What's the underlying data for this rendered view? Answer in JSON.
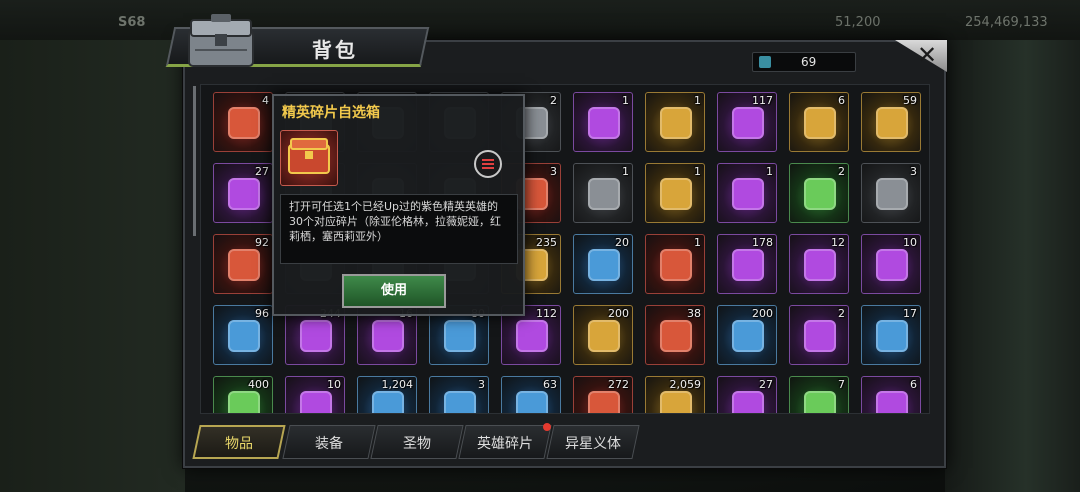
{
  "background": {
    "level": "S68",
    "gold": "51,200",
    "power": "254,469,133"
  },
  "title": "背包",
  "close_label": "✕",
  "counter": {
    "value": "69"
  },
  "popup": {
    "title": "精英碎片自选箱",
    "description": "打开可任选1个已经Up过的紫色精英英雄的30个对应碎片（除亚伦格林，拉薇妮娅，红莉栖，塞西莉亚外）",
    "use_label": "使用"
  },
  "items": [
    {
      "qty": "4",
      "color": "red"
    },
    {
      "qty": "",
      "color": "gray"
    },
    {
      "qty": "",
      "color": "gray"
    },
    {
      "qty": "",
      "color": "gray"
    },
    {
      "qty": "2",
      "color": "gray"
    },
    {
      "qty": "1",
      "color": "purple"
    },
    {
      "qty": "1",
      "color": "gold"
    },
    {
      "qty": "117",
      "color": "purple"
    },
    {
      "qty": "6",
      "color": "gold"
    },
    {
      "qty": "59",
      "color": "gold"
    },
    {
      "qty": "27",
      "color": "purple"
    },
    {
      "qty": "",
      "color": "gray"
    },
    {
      "qty": "",
      "color": "gray"
    },
    {
      "qty": "",
      "color": "gray"
    },
    {
      "qty": "3",
      "color": "red"
    },
    {
      "qty": "1",
      "color": "gray"
    },
    {
      "qty": "1",
      "color": "gold"
    },
    {
      "qty": "1",
      "color": "purple"
    },
    {
      "qty": "2",
      "color": "green"
    },
    {
      "qty": "3",
      "color": "gray"
    },
    {
      "qty": "92",
      "color": "red"
    },
    {
      "qty": "",
      "color": "gray"
    },
    {
      "qty": "",
      "color": "gray"
    },
    {
      "qty": "",
      "color": "gray"
    },
    {
      "qty": "235",
      "color": "gold"
    },
    {
      "qty": "20",
      "color": "blue"
    },
    {
      "qty": "1",
      "color": "red"
    },
    {
      "qty": "178",
      "color": "purple"
    },
    {
      "qty": "12",
      "color": "purple"
    },
    {
      "qty": "10",
      "color": "purple"
    },
    {
      "qty": "96",
      "color": "blue"
    },
    {
      "qty": "244",
      "color": "purple"
    },
    {
      "qty": "16",
      "color": "purple"
    },
    {
      "qty": "80",
      "color": "blue"
    },
    {
      "qty": "112",
      "color": "purple"
    },
    {
      "qty": "200",
      "color": "gold"
    },
    {
      "qty": "38",
      "color": "red"
    },
    {
      "qty": "200",
      "color": "blue"
    },
    {
      "qty": "2",
      "color": "purple"
    },
    {
      "qty": "17",
      "color": "blue"
    },
    {
      "qty": "400",
      "color": "green"
    },
    {
      "qty": "10",
      "color": "purple"
    },
    {
      "qty": "1,204",
      "color": "blue"
    },
    {
      "qty": "3",
      "color": "blue"
    },
    {
      "qty": "63",
      "color": "blue"
    },
    {
      "qty": "272",
      "color": "red"
    },
    {
      "qty": "2,059",
      "color": "gold"
    },
    {
      "qty": "27",
      "color": "purple"
    },
    {
      "qty": "7",
      "color": "green"
    },
    {
      "qty": "6",
      "color": "purple"
    }
  ],
  "tabs": [
    {
      "label": "物品",
      "active": true
    },
    {
      "label": "装备",
      "active": false
    },
    {
      "label": "圣物",
      "active": false
    },
    {
      "label": "英雄碎片",
      "active": false
    },
    {
      "label": "异星义体",
      "active": false
    }
  ],
  "colors": {
    "accent_green": "#86a446",
    "tab_active_border": "#b7a652",
    "title_gold": "#f2c94c",
    "notify_red": "#e53a2f"
  }
}
